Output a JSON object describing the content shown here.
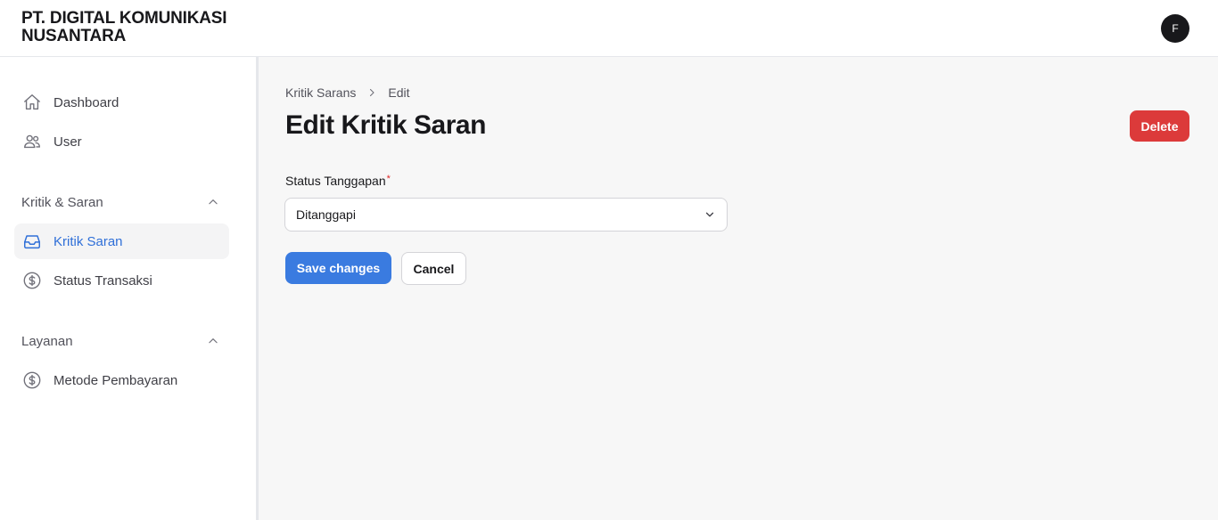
{
  "header": {
    "brand_line1": "PT. DIGITAL KOMUNIKASI",
    "brand_line2": "NUSANTARA",
    "avatar_initial": "F"
  },
  "sidebar": {
    "top_items": [
      {
        "label": "Dashboard",
        "icon": "home-icon"
      },
      {
        "label": "User",
        "icon": "users-icon"
      }
    ],
    "groups": [
      {
        "label": "Kritik & Saran",
        "expanded": true,
        "items": [
          {
            "label": "Kritik Saran",
            "icon": "inbox-icon",
            "active": true
          },
          {
            "label": "Status Transaksi",
            "icon": "dollar-circle-icon",
            "active": false
          }
        ]
      },
      {
        "label": "Layanan",
        "expanded": true,
        "items": [
          {
            "label": "Metode Pembayaran",
            "icon": "dollar-circle-icon",
            "active": false
          }
        ]
      }
    ]
  },
  "main": {
    "breadcrumb": [
      "Kritik Sarans",
      "Edit"
    ],
    "title": "Edit Kritik Saran",
    "delete_label": "Delete",
    "form": {
      "status_label": "Status Tanggapan",
      "required_mark": "*",
      "status_value": "Ditanggapi"
    },
    "save_label": "Save changes",
    "cancel_label": "Cancel"
  },
  "colors": {
    "primary": "#3a7be0",
    "danger": "#dc3a3a",
    "active_nav_text": "#2f6fd8",
    "active_nav_bg": "#f4f4f5",
    "main_bg": "#f7f7f7"
  }
}
